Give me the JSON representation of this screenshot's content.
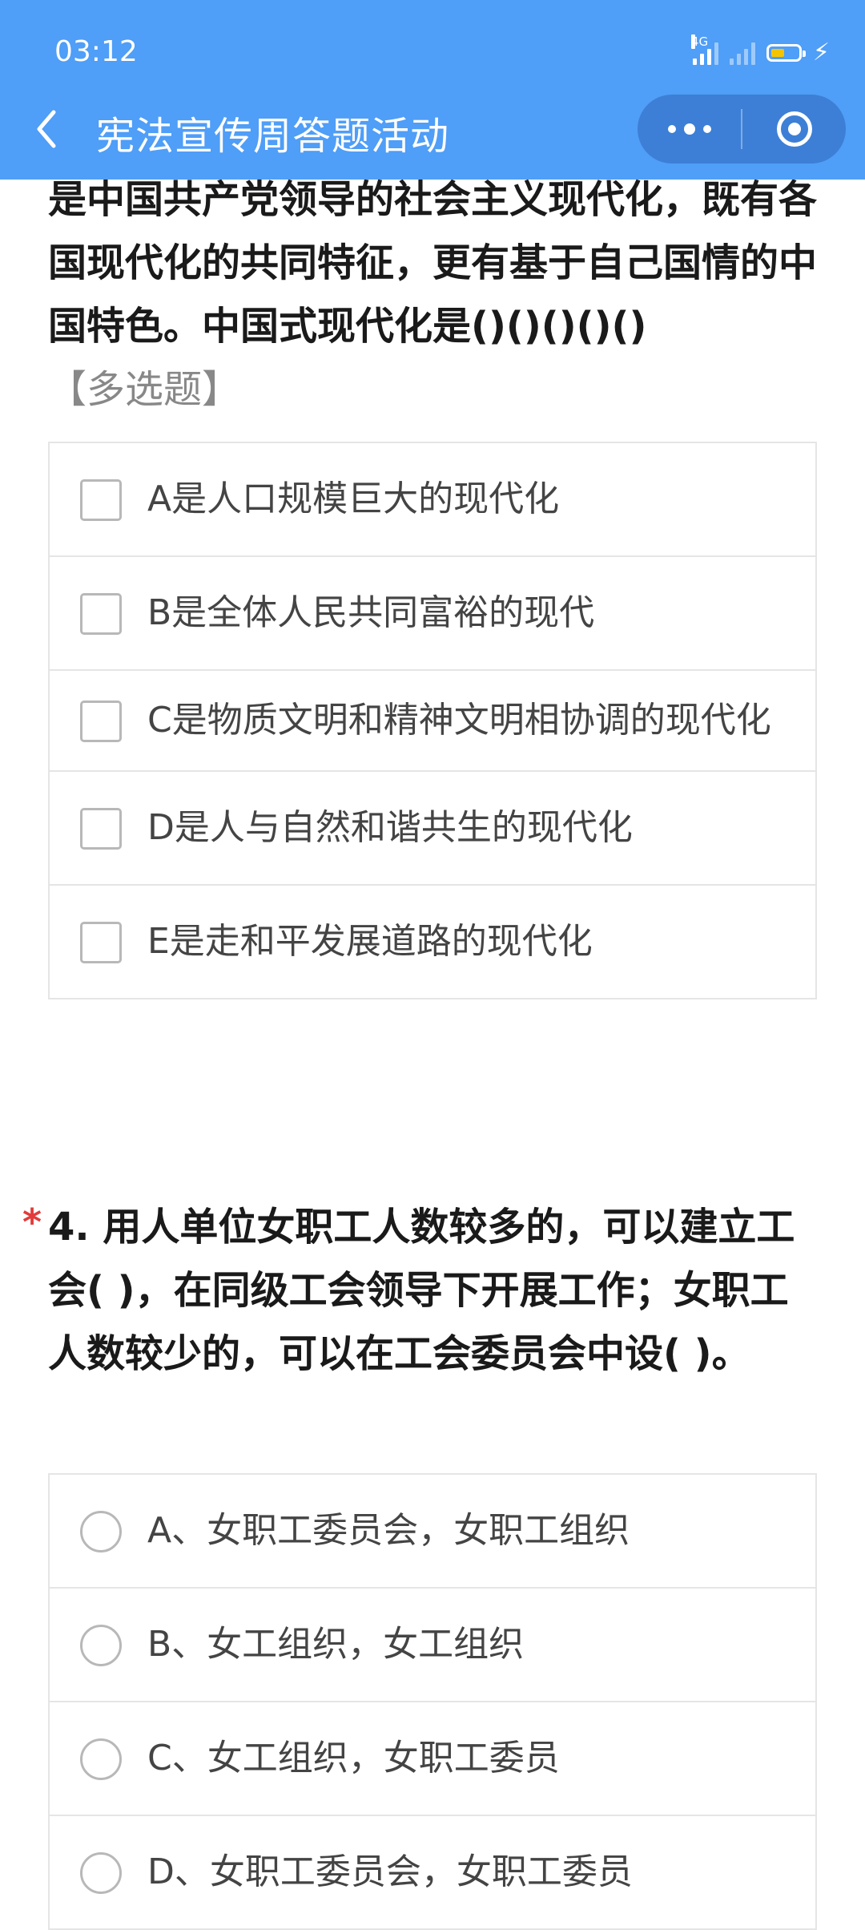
{
  "status_bar": {
    "time": "03:12",
    "network": "4G",
    "icons": [
      "signal-4g-icon",
      "signal-no-sim-icon",
      "battery-low-icon",
      "charging-bolt-icon"
    ]
  },
  "nav": {
    "title": "宪法宣传周答题活动",
    "back_icon": "chevron-left-icon",
    "more_icon": "more-dots-icon",
    "close_icon": "target-close-icon"
  },
  "question3": {
    "text_partial": "是中国共产党领导的社会主义现代化，既有各国现代化的共同特征，更有基于自己国情的中国特色。中国式现代化是()()()()()",
    "type_tag": "【多选题】",
    "options": [
      {
        "label": "A是人口规模巨大的现代化",
        "checked": false
      },
      {
        "label": "B是全体人民共同富裕的现代",
        "checked": false
      },
      {
        "label": "C是物质文明和精神文明相协调的现代化",
        "checked": false
      },
      {
        "label": "D是人与自然和谐共生的现代化",
        "checked": false
      },
      {
        "label": "E是走和平发展道路的现代化",
        "checked": false
      }
    ]
  },
  "question4": {
    "required_mark": "*",
    "text": "4. 用人单位女职工人数较多的，可以建立工会( )，在同级工会领导下开展工作；女职工人数较少的，可以在工会委员会中设( )。",
    "options": [
      {
        "label": "A、女职工委员会，女职工组织",
        "selected": false
      },
      {
        "label": "B、女工组织，女工组织",
        "selected": false
      },
      {
        "label": "C、女工组织，女职工委员",
        "selected": false
      },
      {
        "label": "D、女职工委员会，女职工委员",
        "selected": false
      }
    ]
  },
  "colors": {
    "header_bg": "#4f9ef7",
    "capsule_bg": "#3d7fd6",
    "required": "#e23b3b"
  }
}
